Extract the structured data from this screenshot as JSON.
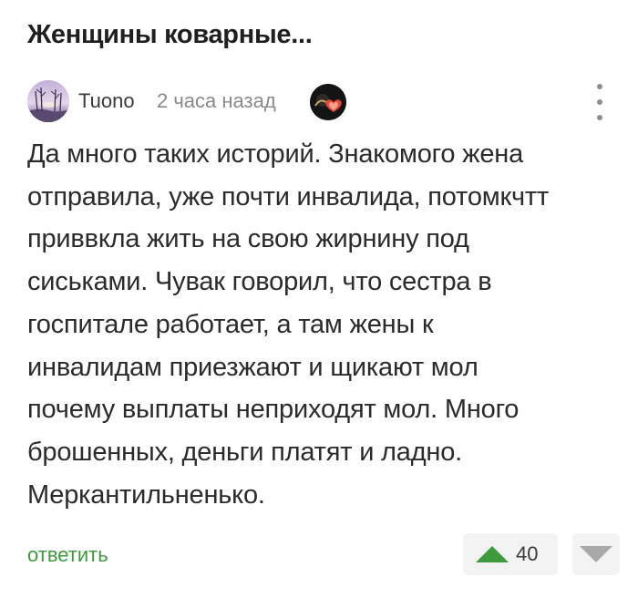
{
  "post": {
    "title": "Женщины коварные..."
  },
  "comment": {
    "author": "Tuono",
    "time": "2 часа назад",
    "avatar_icon": "avatar-winter-sunset",
    "badge_icon": "heart-badge-icon",
    "menu_icon": "more-vertical-icon",
    "body_lines": [
      "Да много таких историй. Знакомого жена",
      "отправила, уже почти инвалида, потомкчтт",
      "приввкла жить на свою жирнину под",
      "сиськами. Чувак говорил, что сестра в",
      "госпитале работает, а там жены к",
      "инвалидам приезжают и щикают мол",
      "почему выплаты неприходят мол. Много",
      "брошенных, деньги платят и ладно.",
      "Меркантильненько."
    ],
    "reply_label": "ответить",
    "rating": "40"
  },
  "colors": {
    "upvote": "#3d9b3d",
    "downvote": "#a9a9a9",
    "reply": "#3d9b3d",
    "badge_heart": "#e2473a"
  }
}
